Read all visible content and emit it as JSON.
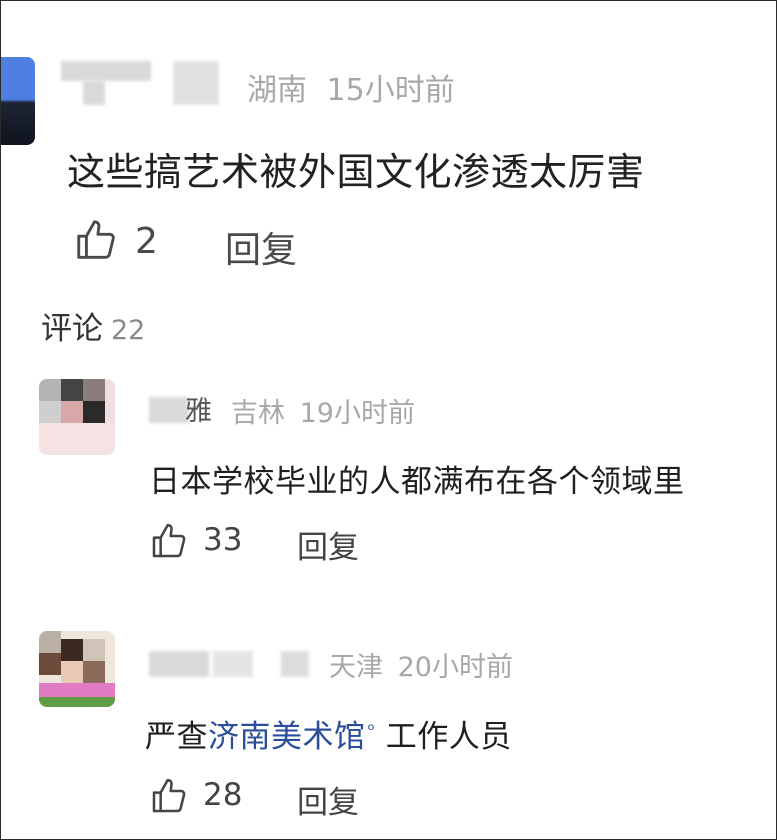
{
  "top_comment": {
    "location": "湖南",
    "time": "15小时前",
    "text": "这些搞艺术被外国文化渗透太厉害",
    "likes": "2",
    "reply_label": "回复"
  },
  "comments_header": {
    "label": "评论",
    "count": "22"
  },
  "replies": [
    {
      "location": "吉林",
      "time": "19小时前",
      "name_suffix": "雅",
      "text": "日本学校毕业的人都满布在各个领域里",
      "likes": "33",
      "reply_label": "回复"
    },
    {
      "location": "天津",
      "time": "20小时前",
      "text_prefix": "严查",
      "text_link": "济南美术馆",
      "text_suffix": " 工作人员",
      "likes": "28",
      "reply_label": "回复"
    }
  ],
  "colors": {
    "link": "#2a4e9a",
    "meta": "#a8a8a8"
  },
  "icons": {
    "like": "thumbs-up-icon",
    "search": "search-icon"
  }
}
